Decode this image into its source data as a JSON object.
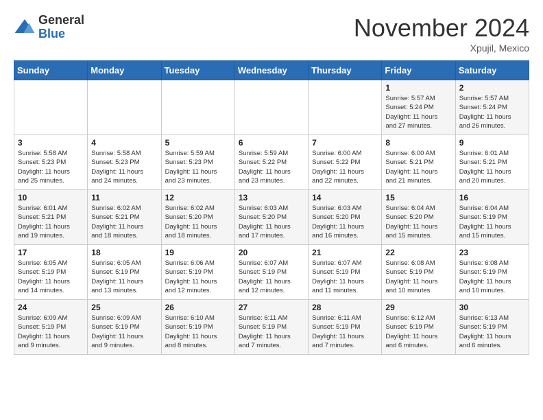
{
  "header": {
    "logo_general": "General",
    "logo_blue": "Blue",
    "month_title": "November 2024",
    "location": "Xpujil, Mexico"
  },
  "weekdays": [
    "Sunday",
    "Monday",
    "Tuesday",
    "Wednesday",
    "Thursday",
    "Friday",
    "Saturday"
  ],
  "weeks": [
    [
      {
        "day": "",
        "info": ""
      },
      {
        "day": "",
        "info": ""
      },
      {
        "day": "",
        "info": ""
      },
      {
        "day": "",
        "info": ""
      },
      {
        "day": "",
        "info": ""
      },
      {
        "day": "1",
        "info": "Sunrise: 5:57 AM\nSunset: 5:24 PM\nDaylight: 11 hours\nand 27 minutes."
      },
      {
        "day": "2",
        "info": "Sunrise: 5:57 AM\nSunset: 5:24 PM\nDaylight: 11 hours\nand 26 minutes."
      }
    ],
    [
      {
        "day": "3",
        "info": "Sunrise: 5:58 AM\nSunset: 5:23 PM\nDaylight: 11 hours\nand 25 minutes."
      },
      {
        "day": "4",
        "info": "Sunrise: 5:58 AM\nSunset: 5:23 PM\nDaylight: 11 hours\nand 24 minutes."
      },
      {
        "day": "5",
        "info": "Sunrise: 5:59 AM\nSunset: 5:23 PM\nDaylight: 11 hours\nand 23 minutes."
      },
      {
        "day": "6",
        "info": "Sunrise: 5:59 AM\nSunset: 5:22 PM\nDaylight: 11 hours\nand 23 minutes."
      },
      {
        "day": "7",
        "info": "Sunrise: 6:00 AM\nSunset: 5:22 PM\nDaylight: 11 hours\nand 22 minutes."
      },
      {
        "day": "8",
        "info": "Sunrise: 6:00 AM\nSunset: 5:21 PM\nDaylight: 11 hours\nand 21 minutes."
      },
      {
        "day": "9",
        "info": "Sunrise: 6:01 AM\nSunset: 5:21 PM\nDaylight: 11 hours\nand 20 minutes."
      }
    ],
    [
      {
        "day": "10",
        "info": "Sunrise: 6:01 AM\nSunset: 5:21 PM\nDaylight: 11 hours\nand 19 minutes."
      },
      {
        "day": "11",
        "info": "Sunrise: 6:02 AM\nSunset: 5:21 PM\nDaylight: 11 hours\nand 18 minutes."
      },
      {
        "day": "12",
        "info": "Sunrise: 6:02 AM\nSunset: 5:20 PM\nDaylight: 11 hours\nand 18 minutes."
      },
      {
        "day": "13",
        "info": "Sunrise: 6:03 AM\nSunset: 5:20 PM\nDaylight: 11 hours\nand 17 minutes."
      },
      {
        "day": "14",
        "info": "Sunrise: 6:03 AM\nSunset: 5:20 PM\nDaylight: 11 hours\nand 16 minutes."
      },
      {
        "day": "15",
        "info": "Sunrise: 6:04 AM\nSunset: 5:20 PM\nDaylight: 11 hours\nand 15 minutes."
      },
      {
        "day": "16",
        "info": "Sunrise: 6:04 AM\nSunset: 5:19 PM\nDaylight: 11 hours\nand 15 minutes."
      }
    ],
    [
      {
        "day": "17",
        "info": "Sunrise: 6:05 AM\nSunset: 5:19 PM\nDaylight: 11 hours\nand 14 minutes."
      },
      {
        "day": "18",
        "info": "Sunrise: 6:05 AM\nSunset: 5:19 PM\nDaylight: 11 hours\nand 13 minutes."
      },
      {
        "day": "19",
        "info": "Sunrise: 6:06 AM\nSunset: 5:19 PM\nDaylight: 11 hours\nand 12 minutes."
      },
      {
        "day": "20",
        "info": "Sunrise: 6:07 AM\nSunset: 5:19 PM\nDaylight: 11 hours\nand 12 minutes."
      },
      {
        "day": "21",
        "info": "Sunrise: 6:07 AM\nSunset: 5:19 PM\nDaylight: 11 hours\nand 11 minutes."
      },
      {
        "day": "22",
        "info": "Sunrise: 6:08 AM\nSunset: 5:19 PM\nDaylight: 11 hours\nand 10 minutes."
      },
      {
        "day": "23",
        "info": "Sunrise: 6:08 AM\nSunset: 5:19 PM\nDaylight: 11 hours\nand 10 minutes."
      }
    ],
    [
      {
        "day": "24",
        "info": "Sunrise: 6:09 AM\nSunset: 5:19 PM\nDaylight: 11 hours\nand 9 minutes."
      },
      {
        "day": "25",
        "info": "Sunrise: 6:09 AM\nSunset: 5:19 PM\nDaylight: 11 hours\nand 9 minutes."
      },
      {
        "day": "26",
        "info": "Sunrise: 6:10 AM\nSunset: 5:19 PM\nDaylight: 11 hours\nand 8 minutes."
      },
      {
        "day": "27",
        "info": "Sunrise: 6:11 AM\nSunset: 5:19 PM\nDaylight: 11 hours\nand 7 minutes."
      },
      {
        "day": "28",
        "info": "Sunrise: 6:11 AM\nSunset: 5:19 PM\nDaylight: 11 hours\nand 7 minutes."
      },
      {
        "day": "29",
        "info": "Sunrise: 6:12 AM\nSunset: 5:19 PM\nDaylight: 11 hours\nand 6 minutes."
      },
      {
        "day": "30",
        "info": "Sunrise: 6:13 AM\nSunset: 5:19 PM\nDaylight: 11 hours\nand 6 minutes."
      }
    ]
  ]
}
